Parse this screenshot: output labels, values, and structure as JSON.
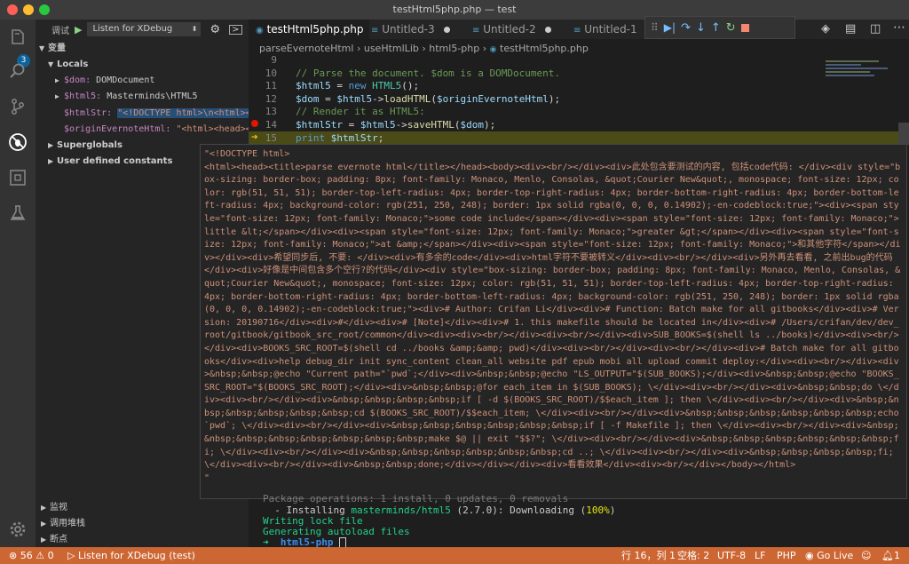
{
  "window": {
    "title": "testHtml5php.php — test"
  },
  "activity": {
    "badge": "3"
  },
  "debug": {
    "label": "调试",
    "config": "Listen for XDebug"
  },
  "sidebar": {
    "variables_header": "变量",
    "locals": "Locals",
    "vars": [
      {
        "name": "$dom:",
        "value": "DOMDocument"
      },
      {
        "name": "$html5:",
        "value": "Masterminds\\HTML5"
      },
      {
        "name": "$htmlStr:",
        "value": "\"<!DOCTYPE html>\\n<html><he…"
      },
      {
        "name": "$originEvernoteHtml:",
        "value": "\"<html><head><ti…"
      }
    ],
    "superglobals": "Superglobals",
    "user_constants": "User defined constants",
    "watch": "监视",
    "callstack": "调用堆栈",
    "breakpoints": "断点"
  },
  "tabs": [
    {
      "label": "testHtml5php.php"
    },
    {
      "label": "Untitled-3"
    },
    {
      "label": "Untitled-2"
    },
    {
      "label": "Untitled-1"
    }
  ],
  "breadcrumb": {
    "file": "parseEvernoteHtml",
    "sep": "›",
    "ns": "useHtmlLib",
    "folder": "html5-php",
    "leaf": "testHtml5php.php"
  },
  "editor": {
    "lines": [
      {
        "n": "9",
        "parts": [
          {
            "t": "",
            "c": "c-plain"
          }
        ]
      },
      {
        "n": "10",
        "parts": [
          {
            "t": "// Parse the document. $dom is a DOMDocument.",
            "c": "c-comment"
          }
        ]
      },
      {
        "n": "11",
        "parts": [
          {
            "t": "$html5",
            "c": "c-var"
          },
          {
            "t": " = ",
            "c": "c-plain"
          },
          {
            "t": "new",
            "c": "c-kw"
          },
          {
            "t": " ",
            "c": "c-plain"
          },
          {
            "t": "HTML5",
            "c": "c-cls"
          },
          {
            "t": "();",
            "c": "c-plain"
          }
        ]
      },
      {
        "n": "12",
        "parts": [
          {
            "t": "$dom",
            "c": "c-var"
          },
          {
            "t": " = ",
            "c": "c-plain"
          },
          {
            "t": "$html5",
            "c": "c-var"
          },
          {
            "t": "->",
            "c": "c-plain"
          },
          {
            "t": "loadHTML",
            "c": "c-fn"
          },
          {
            "t": "(",
            "c": "c-plain"
          },
          {
            "t": "$originEvernoteHtml",
            "c": "c-var"
          },
          {
            "t": ");",
            "c": "c-plain"
          }
        ]
      },
      {
        "n": "13",
        "parts": [
          {
            "t": "// Render it as HTML5:",
            "c": "c-comment"
          }
        ]
      },
      {
        "n": "14",
        "parts": [
          {
            "t": "$htmlStr",
            "c": "c-var"
          },
          {
            "t": " = ",
            "c": "c-plain"
          },
          {
            "t": "$html5",
            "c": "c-var"
          },
          {
            "t": "->",
            "c": "c-plain"
          },
          {
            "t": "saveHTML",
            "c": "c-fn"
          },
          {
            "t": "(",
            "c": "c-plain"
          },
          {
            "t": "$dom",
            "c": "c-var"
          },
          {
            "t": ");",
            "c": "c-plain"
          }
        ]
      },
      {
        "n": "15",
        "parts": [
          {
            "t": "print",
            "c": "c-kw"
          },
          {
            "t": " ",
            "c": "c-plain"
          },
          {
            "t": "$htmlStr",
            "c": "c-var"
          },
          {
            "t": ";",
            "c": "c-plain"
          }
        ]
      }
    ]
  },
  "hover": {
    "text": "\"<!DOCTYPE html>\n<html><head><title>parse evernote html</title></head><body><div><br/></div><div>此处包含要测试的内容, 包括code代码: </div><div style=\"box-sizing: border-box; padding: 8px; font-family: Monaco, Menlo, Consolas, &quot;Courier New&quot;, monospace; font-size: 12px; color: rgb(51, 51, 51); border-top-left-radius: 4px; border-top-right-radius: 4px; border-bottom-right-radius: 4px; border-bottom-left-radius: 4px; background-color: rgb(251, 250, 248); border: 1px solid rgba(0, 0, 0, 0.14902);-en-codeblock:true;\"><div><span style=\"font-size: 12px; font-family: Monaco;\">some code include</span></div><div><span style=\"font-size: 12px; font-family: Monaco;\">little &lt;</span></div><div><span style=\"font-size: 12px; font-family: Monaco;\">greater &gt;</span></div><div><span style=\"font-size: 12px; font-family: Monaco;\">at &amp;</span></div><div><span style=\"font-size: 12px; font-family: Monaco;\">和其他字符</span></div></div><div>希望同步后, 不要: </div><div>有多余的code</div><div>html字符不要被转义</div><div><br/></div><div>另外再去看看, 之前出bug的代码</div><div>好像是中间包含多个空行?的代码</div><div style=\"box-sizing: border-box; padding: 8px; font-family: Monaco, Menlo, Consolas, &quot;Courier New&quot;, monospace; font-size: 12px; color: rgb(51, 51, 51); border-top-left-radius: 4px; border-top-right-radius: 4px; border-bottom-right-radius: 4px; border-bottom-left-radius: 4px; background-color: rgb(251, 250, 248); border: 1px solid rgba(0, 0, 0, 0.14902);-en-codeblock:true;\"><div># Author: Crifan Li</div><div># Function: Batch make for all gitbooks</div><div># Version: 20190716</div><div>#</div><div># [Note]</div><div># 1. this makefile should be located in</div><div># /Users/crifan/dev/dev_root/gitbook/gitbook_src_root/common</div><div><div><br/></div><div><br/></div><div>SUB_BOOKS=$(shell ls ../books)</div><div><br/></div><div>BOOKS_SRC_ROOT=$(shell cd ../books &amp;&amp; pwd)</div><div><br/></div><div><br/></div><div># Batch make for all gitbooks</div><div>help debug_dir init sync_content clean_all website pdf epub mobi all upload commit deploy:</div><div><br/></div><div>&nbsp;&nbsp;@echo \"Current path=\"`pwd`;</div><div>&nbsp;&nbsp;@echo \"LS_OUTPUT=\"$(SUB_BOOKS);</div><div>&nbsp;&nbsp;@echo \"BOOKS_SRC_ROOT=\"$(BOOKS_SRC_ROOT);</div><div>&nbsp;&nbsp;@for each_item in $(SUB_BOOKS); \\</div><div><br/></div><div>&nbsp;&nbsp;do \\</div><div><br/></div><div>&nbsp;&nbsp;&nbsp;&nbsp;if [ -d $(BOOKS_SRC_ROOT)/$$each_item ]; then \\</div><div><br/></div><div>&nbsp;&nbsp;&nbsp;&nbsp;&nbsp;&nbsp;cd $(BOOKS_SRC_ROOT)/$$each_item; \\</div><div><br/></div><div>&nbsp;&nbsp;&nbsp;&nbsp;&nbsp;&nbsp;echo `pwd`; \\</div><div><br/></div><div>&nbsp;&nbsp;&nbsp;&nbsp;&nbsp;&nbsp;if [ -f Makefile ]; then \\</div><div><br/></div><div>&nbsp;&nbsp;&nbsp;&nbsp;&nbsp;&nbsp;&nbsp;&nbsp;make $@ || exit \"$$?\"; \\</div><div><br/></div><div>&nbsp;&nbsp;&nbsp;&nbsp;&nbsp;&nbsp;fi; \\</div><div><br/></div><div>&nbsp;&nbsp;&nbsp;&nbsp;&nbsp;&nbsp;cd ..; \\</div><div><br/></div><div>&nbsp;&nbsp;&nbsp;&nbsp;fi; \\</div><div><br/></div><div>&nbsp;&nbsp;done;</div></div></div><div>看看效果</div><div><br/></div></body></html>\n\""
  },
  "terminal": {
    "line1": "Package operations: 1 install, 0 updates, 0 removals",
    "line2_a": "  - Installing ",
    "line2_pkg": "masterminds/html5",
    "line2_b": " (2.7.0): Downloading (",
    "line2_pct": "100%",
    "line2_c": ")",
    "line3": "Writing lock file",
    "line4": "Generating autoload files",
    "prompt_arrow": "➜",
    "prompt_dir": "html5-php"
  },
  "status": {
    "errors": "56",
    "warnings": "0",
    "debug": "Listen for XDebug (test)",
    "position": "行 16，列 1",
    "spaces": "空格: 2",
    "encoding": "UTF-8",
    "eol": "LF",
    "lang": "PHP",
    "golive": "Go Live",
    "notifications": "1"
  }
}
